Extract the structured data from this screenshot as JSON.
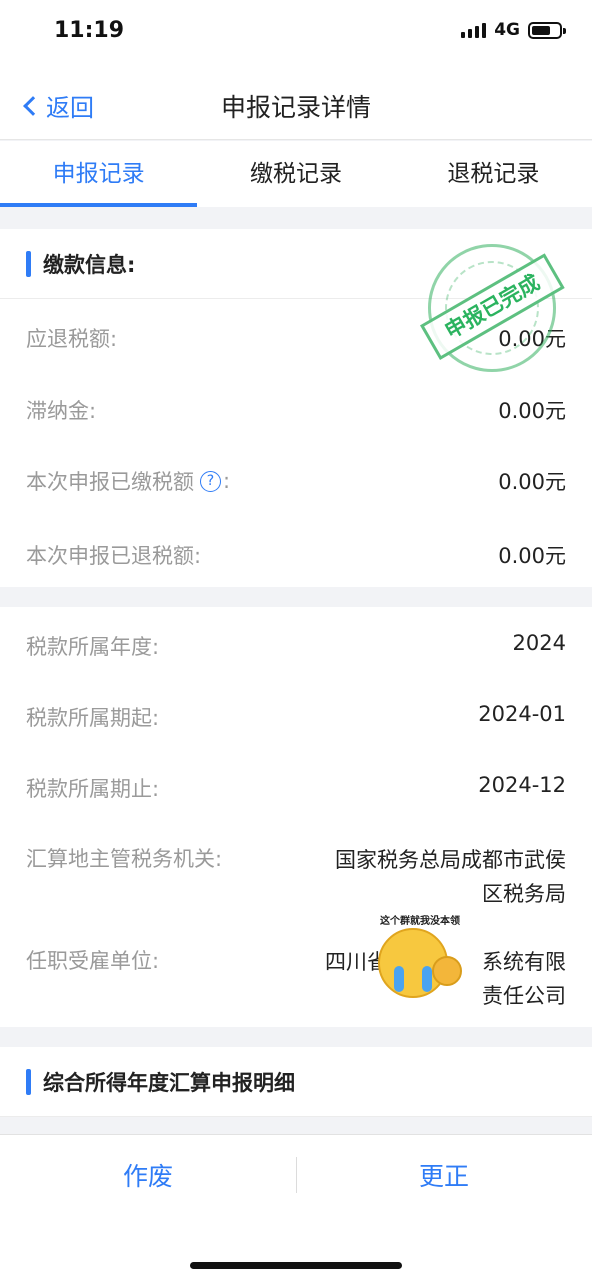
{
  "status_bar": {
    "time": "11:19",
    "network": "4G"
  },
  "nav": {
    "back_label": "返回",
    "title": "申报记录详情"
  },
  "tabs": [
    {
      "label": "申报记录",
      "active": true
    },
    {
      "label": "缴税记录",
      "active": false
    },
    {
      "label": "退税记录",
      "active": false
    }
  ],
  "payment": {
    "title": "缴款信息:",
    "stamp_text": "申报已完成",
    "rows": [
      {
        "label": "应退税额:",
        "value": "0.00元"
      },
      {
        "label": "滞纳金:",
        "value": "0.00元"
      },
      {
        "label": "本次申报已缴税额",
        "suffix": ":",
        "value": "0.00元"
      },
      {
        "label": "本次申报已退税额:",
        "value": "0.00元"
      }
    ]
  },
  "period": {
    "rows": [
      {
        "label": "税款所属年度:",
        "value": "2024"
      },
      {
        "label": "税款所属期起:",
        "value": "2024-01"
      },
      {
        "label": "税款所属期止:",
        "value": "2024-12"
      },
      {
        "label": "汇算地主管税务机关:",
        "value_line1": "国家税务总局成都市武侯",
        "value_line2": "区税务局"
      },
      {
        "label": "任职受雇单位:",
        "value_prefix": "四川省",
        "value_line1_suffix": "系统有限",
        "value_line2": "责任公司"
      }
    ]
  },
  "sticker": {
    "caption": "这个群就我没本领"
  },
  "detail": {
    "title": "综合所得年度汇算申报明细"
  },
  "actions": {
    "void_label": "作废",
    "correct_label": "更正"
  },
  "colors": {
    "accent": "#2f7cf6",
    "stamp": "#2bb35f"
  }
}
